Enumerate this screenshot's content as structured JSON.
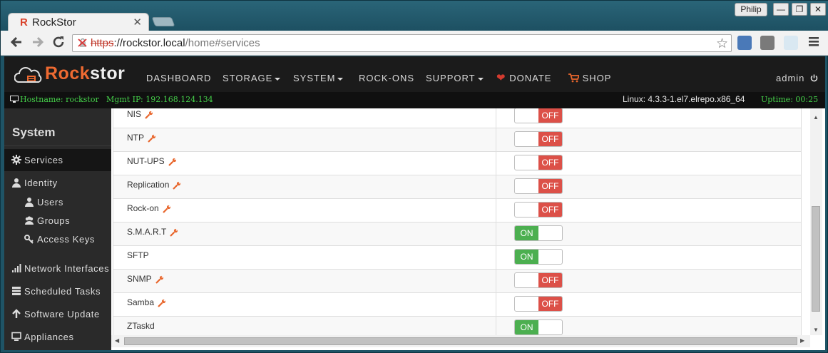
{
  "browser": {
    "tab_title": "RockStor",
    "tab_favicon": "R",
    "tab_close": "✕",
    "user_badge": "Philip",
    "window_buttons": {
      "minimize": "—",
      "maximize": "❐",
      "close": "✕"
    },
    "url": {
      "scheme": "https",
      "sep": "://",
      "host": "rockstor.local",
      "path": "/home#services"
    }
  },
  "navbar": {
    "logo_text_a": "Rock",
    "logo_text_b": "stor",
    "items": [
      "DASHBOARD",
      "STORAGE",
      "SYSTEM",
      "ROCK-ONS",
      "SUPPORT",
      "DONATE",
      "SHOP"
    ],
    "user": "admin",
    "brand_color": "#ee6a31"
  },
  "status": {
    "hostname": "Hostname: rockstor",
    "mgmt_ip": "Mgmt IP: 192.168.124.134",
    "kernel": "Linux: 4.3.3-1.el7.elrepo.x86_64",
    "uptime": "Uptime: 00:25",
    "color": "#45d14a"
  },
  "sidebar": {
    "title": "System",
    "items": {
      "services": "Services",
      "identity": "Identity",
      "users": "Users",
      "groups": "Groups",
      "access_keys": "Access Keys",
      "network": "Network Interfaces",
      "tasks": "Scheduled Tasks",
      "update": "Software Update",
      "appliances": "Appliances"
    }
  },
  "services": {
    "on_label": "ON",
    "off_label": "OFF",
    "rows": [
      {
        "name": "NIS",
        "config": true,
        "state": "OFF"
      },
      {
        "name": "NTP",
        "config": true,
        "state": "OFF"
      },
      {
        "name": "NUT-UPS",
        "config": true,
        "state": "OFF"
      },
      {
        "name": "Replication",
        "config": true,
        "state": "OFF"
      },
      {
        "name": "Rock-on",
        "config": true,
        "state": "OFF"
      },
      {
        "name": "S.M.A.R.T",
        "config": true,
        "state": "ON"
      },
      {
        "name": "SFTP",
        "config": false,
        "state": "ON"
      },
      {
        "name": "SNMP",
        "config": true,
        "state": "OFF"
      },
      {
        "name": "Samba",
        "config": true,
        "state": "OFF"
      },
      {
        "name": "ZTaskd",
        "config": false,
        "state": "ON"
      }
    ]
  }
}
